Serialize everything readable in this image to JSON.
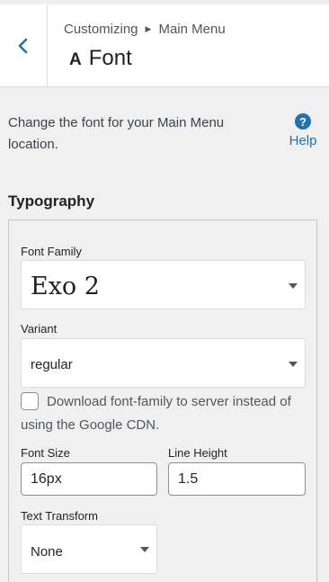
{
  "header": {
    "back_icon": "chevron-left-icon",
    "breadcrumb_root": "Customizing",
    "breadcrumb_sep_icon": "triangle-right-icon",
    "breadcrumb_current": "Main Menu",
    "title_icon": "A",
    "title": "Font"
  },
  "description": "Change the font for your Main Menu location.",
  "help": {
    "icon": "?",
    "label": "Help"
  },
  "section": {
    "title": "Typography",
    "font_family": {
      "label": "Font Family",
      "value": "Exo 2"
    },
    "variant": {
      "label": "Variant",
      "value": "regular"
    },
    "download": {
      "label": "Download font-family to server instead of using the Google CDN.",
      "checked": false
    },
    "font_size": {
      "label": "Font Size",
      "value": "16px"
    },
    "line_height": {
      "label": "Line Height",
      "value": "1.5"
    },
    "text_transform": {
      "label": "Text Transform",
      "value": "None"
    }
  },
  "colors": {
    "accent": "#2271b1",
    "background": "#f0f0f1"
  }
}
